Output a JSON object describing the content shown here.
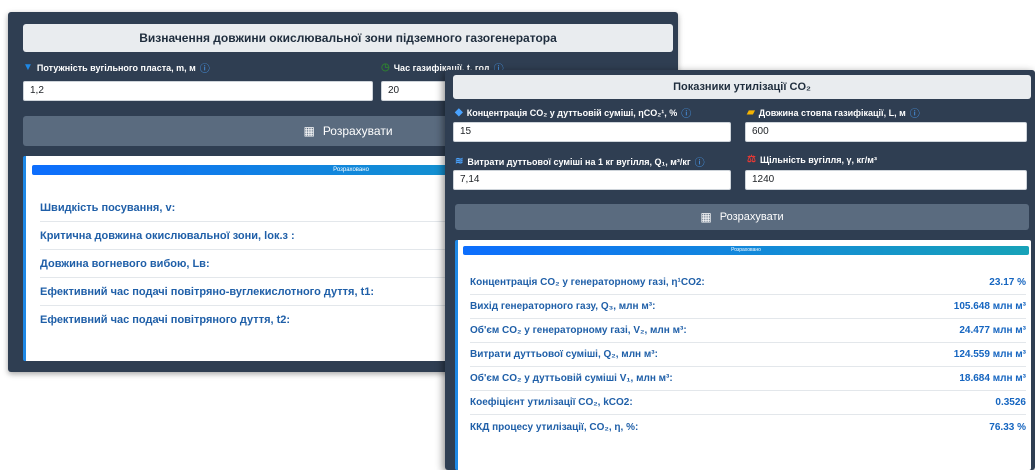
{
  "windowA": {
    "title": "Визначення довжини окислювальної зони підземного газогенератора",
    "field1": {
      "label": "Потужність вугільного пласта, m, м",
      "value": "1,2"
    },
    "field2": {
      "label": "Час газифікації, t, год",
      "value": "20"
    },
    "calc_label": "Розрахувати",
    "progress_label": "Розраховано",
    "progress": 1.0,
    "results": [
      "Швидкість посування, v:",
      "Критична довжина окислювальної зони, lок.з :",
      "Довжина вогневого вибою, Lв:",
      "Ефективний час подачі повітряно-вуглекислотного дуття, t1:",
      "Ефективний час подачі повітряного дуття, t2:"
    ]
  },
  "windowB": {
    "title": "Показники утилізації CO₂",
    "fields": {
      "f1": {
        "label": "Концентрація CO₂ у дуттьовій суміші, ηCO₂¹, %",
        "value": "15",
        "icon": "droplet-icon"
      },
      "f2": {
        "label": "Довжина стовпа газифікації, L, м",
        "value": "600",
        "icon": "ruler-icon"
      },
      "f3": {
        "label": "Витрати дуттьової суміші на 1 кг вугілля, Q₁, м³/кг",
        "value": "7,14",
        "icon": "wind-icon"
      },
      "f4": {
        "label": "Щільність вугілля, γ, кг/м³",
        "value": "1240",
        "icon": "weight-icon"
      }
    },
    "calc_label": "Розрахувати",
    "progress_label": "Розраховано",
    "progress": 1.0,
    "results": [
      {
        "label": "Концентрація CO₂ у генераторному газі, η¹CO2:",
        "value": "23.17 %"
      },
      {
        "label": "Вихід генераторного газу, Q₃, млн м³:",
        "value": "105.648 млн м³"
      },
      {
        "label": "Об'єм CO₂ у генераторному газі, V₂, млн м³:",
        "value": "24.477 млн м³"
      },
      {
        "label": "Витрати дуттьової суміші, Q₂, млн м³:",
        "value": "124.559 млн м³"
      },
      {
        "label": "Об'єм CO₂ у дуттьовій суміші V₁, млн м³:",
        "value": "18.684 млн м³"
      },
      {
        "label": "Коефіцієнт утилізації CO₂, kCO2:",
        "value": "0.3526"
      },
      {
        "label": "ККД процесу утилізації, CO₂, η, %:",
        "value": "76.33 %"
      }
    ]
  },
  "icons": {
    "info": "ⓘ",
    "calculator": "▦"
  },
  "colors": {
    "accent": "#1e88e5",
    "window_bg": "#2f3e52",
    "button_bg": "#5a6b7f",
    "result_text": "#1f5fa8"
  }
}
